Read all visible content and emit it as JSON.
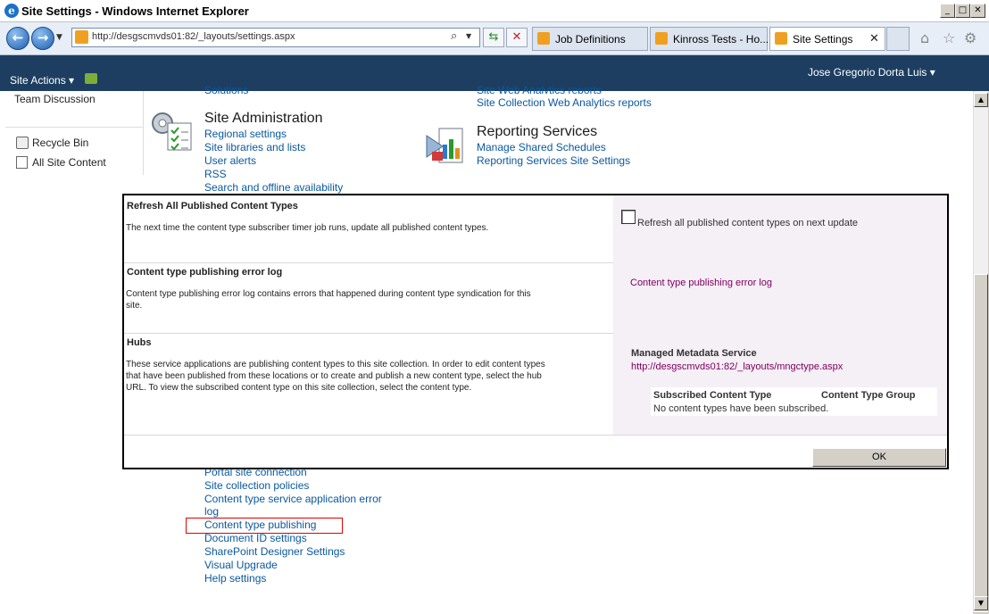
{
  "window": {
    "title": "Site Settings - Windows Internet Explorer"
  },
  "browser": {
    "address": "http://desgscmvds01:82/_layouts/settings.aspx",
    "tabs": [
      {
        "label": "Job Definitions"
      },
      {
        "label": "Kinross Tests - Ho..."
      },
      {
        "label": "Site Settings"
      }
    ]
  },
  "ribbon": {
    "site_actions": "Site Actions ▾",
    "user": "Jose Gregorio Dorta Luis ▾"
  },
  "leftnav": {
    "team_discussion": "Team Discussion",
    "recycle_bin": "Recycle Bin",
    "all_site_content": "All Site Content"
  },
  "site_admin": {
    "heading": "Site Administration",
    "links": [
      "Regional settings",
      "Site libraries and lists",
      "User alerts",
      "RSS",
      "Search and offline availability"
    ],
    "partial_top": "Solutions"
  },
  "reporting": {
    "partial_top": "Site Web Analytics reports",
    "collection_analytics": "Site Collection Web Analytics reports",
    "heading": "Reporting Services",
    "links": [
      "Manage Shared Schedules",
      "Reporting Services Site Settings"
    ]
  },
  "lower_links": {
    "portal": "Portal site connection",
    "policies": "Site collection policies",
    "ct_error_1": "Content type service application error",
    "ct_error_2": "log",
    "ct_publishing": "Content type publishing",
    "doc_id": "Document ID settings",
    "spd": "SharePoint Designer Settings",
    "visual": "Visual Upgrade",
    "help": "Help settings"
  },
  "dialog": {
    "refresh": {
      "title": "Refresh All Published Content Types",
      "desc": "The next time the content type subscriber timer job runs, update all published content types.",
      "checkbox_label": "Refresh all published content types on next update"
    },
    "errorlog": {
      "title": "Content type publishing error log",
      "desc": "Content type publishing error log contains errors that happened during content type syndication for this site.",
      "link": "Content type publishing error log"
    },
    "hubs": {
      "title": "Hubs",
      "desc": "These service applications are publishing content types to this site collection.  In order to edit content types that have been published from these locations or to create and publish a new content type, select the hub URL.  To view the subscribed content type on this site collection, select the content type.",
      "service_name": "Managed Metadata Service",
      "service_url": "http://desgscmvds01:82/_layouts/mngctype.aspx",
      "col_subscribed": "Subscribed Content Type",
      "col_group": "Content Type Group",
      "empty": "No content types have been subscribed."
    },
    "ok": "OK"
  },
  "colors": {
    "ribbon": "#1d3e60",
    "link": "#0a58a0",
    "visited_link": "#800060",
    "panel": "#f5eff6",
    "highlight": "#e00000"
  }
}
